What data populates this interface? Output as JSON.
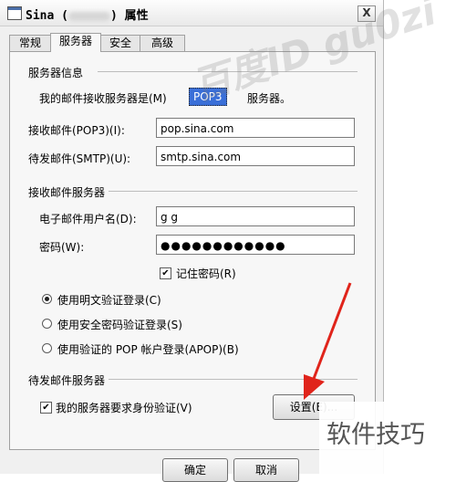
{
  "titlebar": {
    "title_prefix": "Sina (",
    "title_suffix": ") 属性",
    "close": "X"
  },
  "tabs": [
    "常规",
    "服务器",
    "安全",
    "高级"
  ],
  "server_info": {
    "heading": "服务器信息",
    "incoming_type_label": "我的邮件接收服务器是(M)",
    "incoming_type_value": "POP3",
    "incoming_type_suffix": "服务器。",
    "pop3_label": "接收邮件(POP3)(I):",
    "pop3_value": "pop.sina.com",
    "smtp_label": "待发邮件(SMTP)(U):",
    "smtp_value": "smtp.sina.com"
  },
  "incoming_server": {
    "heading": "接收邮件服务器",
    "username_label": "电子邮件用户名(D):",
    "username_value": "g        g",
    "password_label": "密码(W):",
    "password_value": "●●●●●●●●●●●●",
    "remember_password": "记住密码(R)",
    "options": [
      "使用明文验证登录(C)",
      "使用安全密码验证登录(S)",
      "使用验证的 POP 帐户登录(APOP)(B)"
    ]
  },
  "outgoing_server": {
    "heading": "待发邮件服务器",
    "requires_auth": "我的服务器要求身份验证(V)",
    "settings_button": "设置(E)..."
  },
  "footer": {
    "ok": "确定",
    "cancel": "取消"
  },
  "watermarks": {
    "diagonal": "百度ID gu0zi",
    "corner": "软件技巧"
  },
  "colors": {
    "selection": "#3a6fd8",
    "arrow": "#e0241b"
  }
}
